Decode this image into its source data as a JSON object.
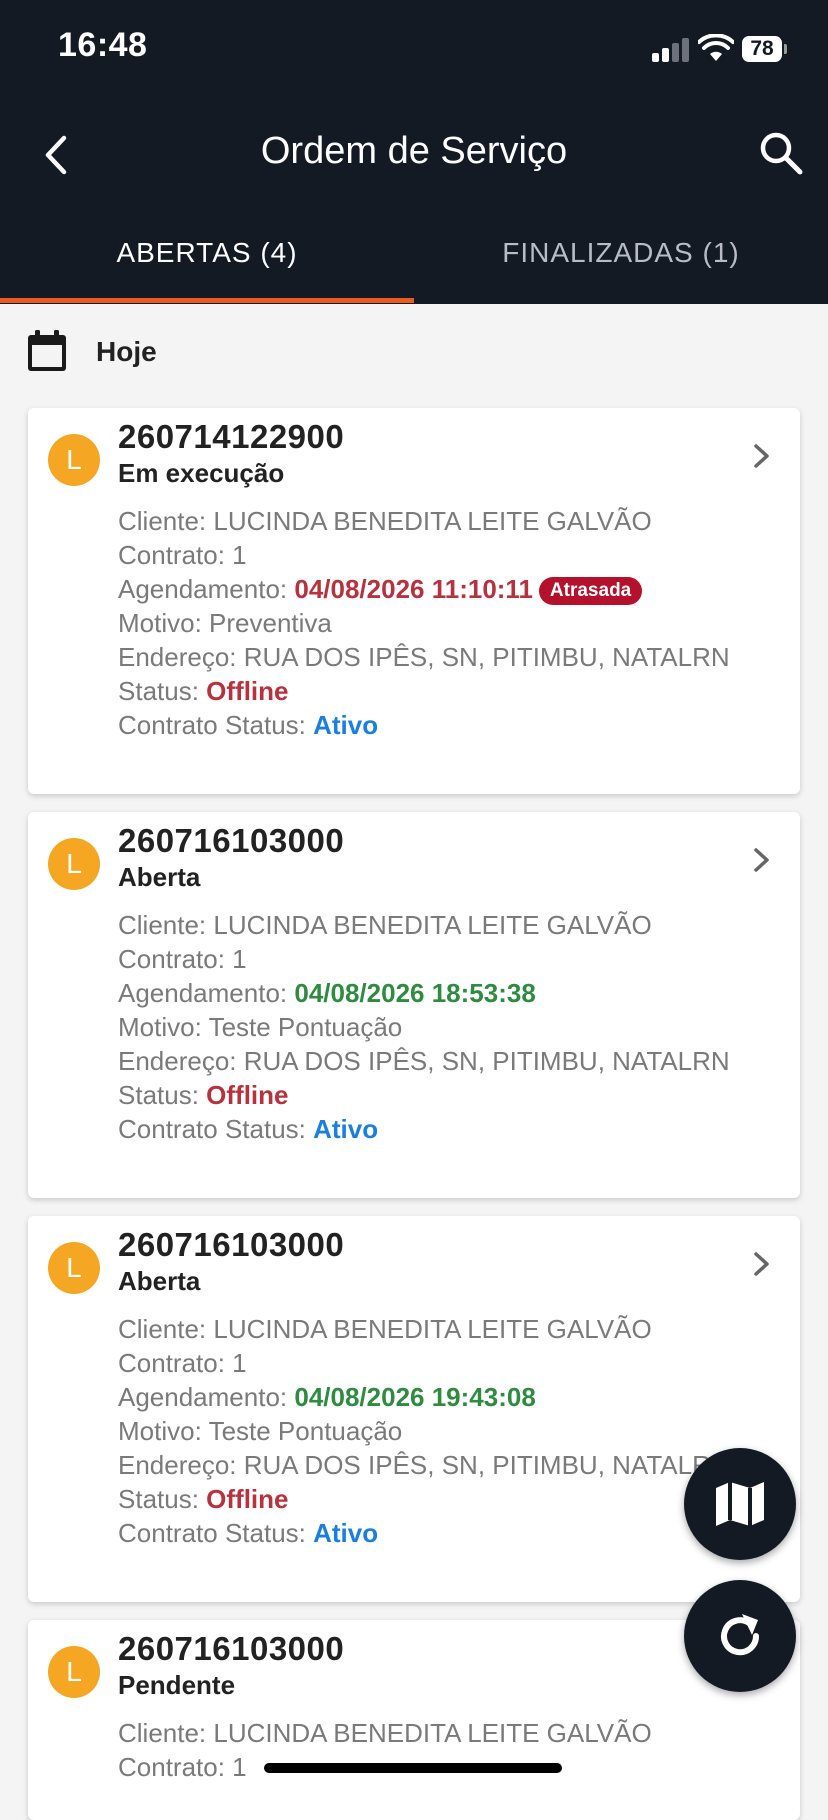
{
  "status_bar": {
    "time": "16:48",
    "battery": "78"
  },
  "nav": {
    "title": "Ordem de Serviço"
  },
  "tabs": [
    {
      "label": "ABERTAS (4)",
      "active": true
    },
    {
      "label": "FINALIZADAS (1)",
      "active": false
    }
  ],
  "date_group": {
    "label": "Hoje"
  },
  "labels": {
    "cliente": "Cliente: ",
    "contrato": "Contrato: ",
    "agendamento": "Agendamento: ",
    "motivo": "Motivo: ",
    "endereco": "Endereço: ",
    "status": "Status: ",
    "contrato_status": "Contrato Status: "
  },
  "orders": [
    {
      "avatar": "L",
      "number": "260714122900",
      "state": "Em execução",
      "cliente": "LUCINDA BENEDITA LEITE GALVÃO",
      "contrato": "1",
      "agendamento": "04/08/2026 11:10:11",
      "badge": "Atrasada",
      "motivo": "Preventiva",
      "endereco": "RUA DOS IPÊS, SN, PITIMBU, NATALRN",
      "status": "Offline",
      "contrato_status": "Ativo"
    },
    {
      "avatar": "L",
      "number": "260716103000",
      "state": "Aberta",
      "cliente": "LUCINDA BENEDITA LEITE GALVÃO",
      "contrato": "1",
      "agendamento": "04/08/2026 18:53:38",
      "motivo": "Teste Pontuação",
      "endereco": "RUA DOS IPÊS, SN, PITIMBU, NATALRN",
      "status": "Offline",
      "contrato_status": "Ativo"
    },
    {
      "avatar": "L",
      "number": "260716103000",
      "state": "Aberta",
      "cliente": "LUCINDA BENEDITA LEITE GALVÃO",
      "contrato": "1",
      "agendamento": "04/08/2026 19:43:08",
      "motivo": "Teste Pontuação",
      "endereco": "RUA DOS IPÊS, SN, PITIMBU, NATALRN",
      "status": "Offline",
      "contrato_status": "Ativo"
    },
    {
      "avatar": "L",
      "number": "260716103000",
      "state": "Pendente",
      "cliente": "LUCINDA BENEDITA LEITE GALVÃO",
      "contrato": "1"
    }
  ],
  "colors": {
    "header": "#141a24",
    "accent": "#e85d1e",
    "late": "#b8323e",
    "on_time": "#2e8b3f",
    "active": "#1a7fe0",
    "avatar": "#f5a623"
  },
  "icons": [
    "back-icon",
    "search-icon",
    "calendar-icon",
    "chevron-right-icon",
    "map-icon",
    "refresh-icon"
  ]
}
